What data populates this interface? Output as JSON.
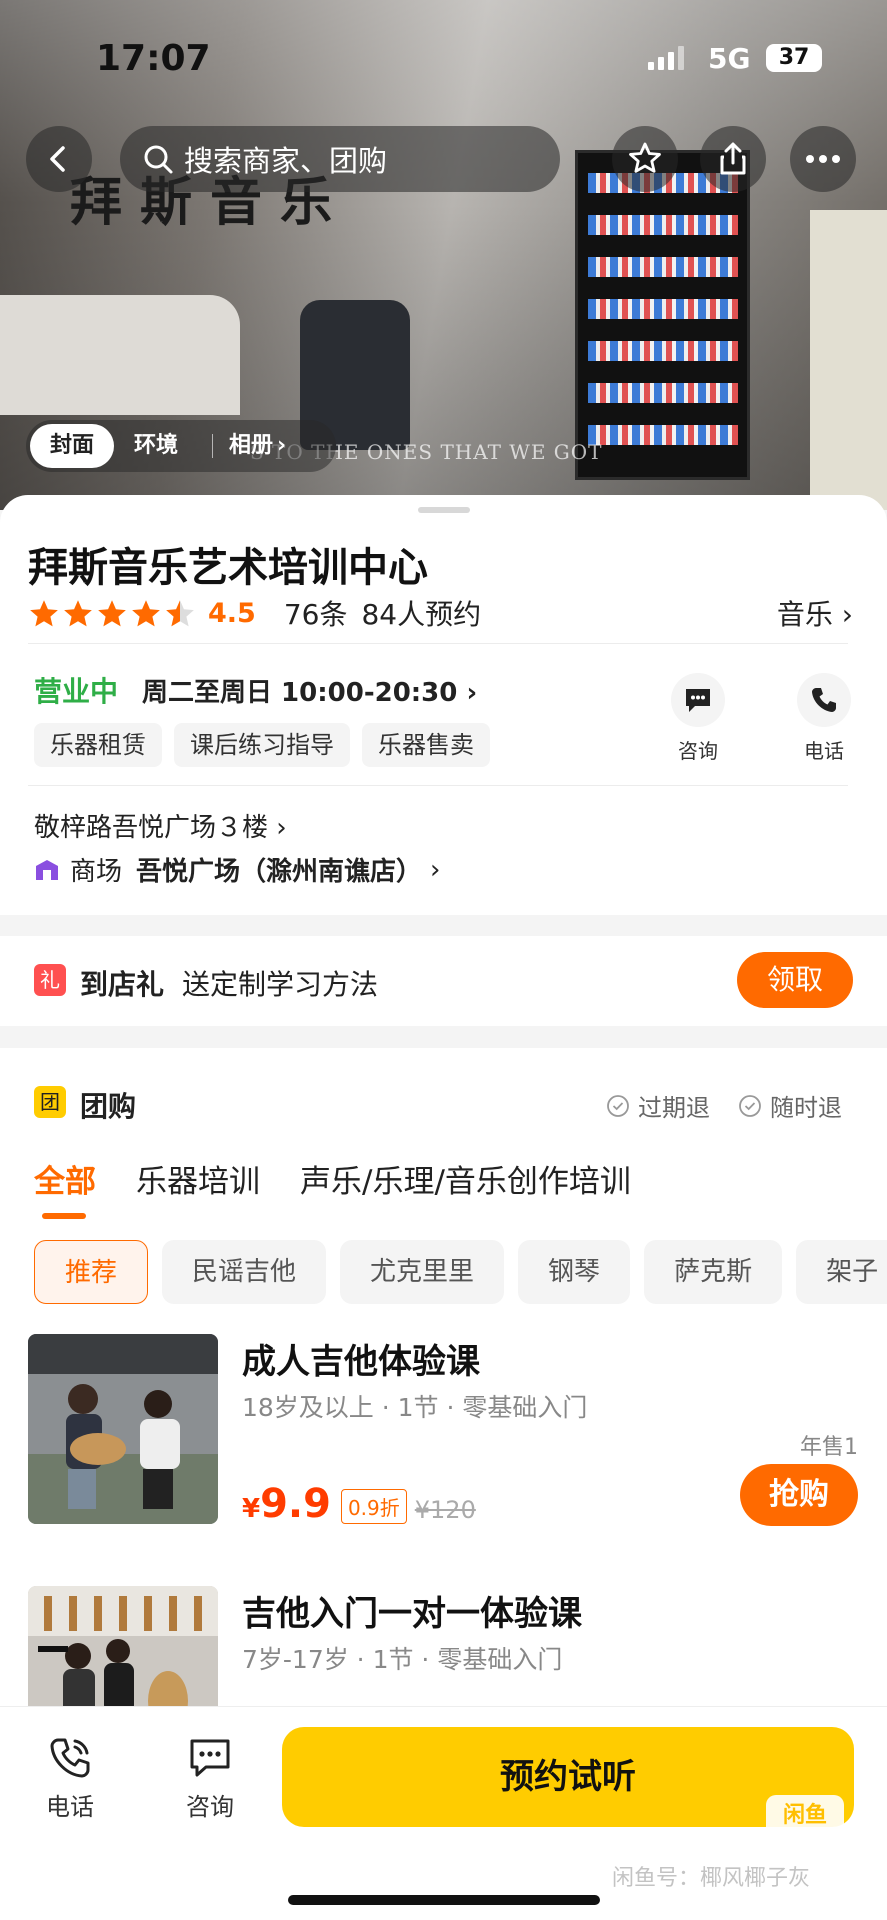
{
  "status_bar": {
    "time": "17:07",
    "network": "5G",
    "battery": "37"
  },
  "search": {
    "placeholder": "搜索商家、团购"
  },
  "hero": {
    "sign_text": "拜斯音乐",
    "wall_text": "S TO THE ONES THAT WE GOT",
    "album_tabs": [
      "封面",
      "环境",
      "相册"
    ]
  },
  "shop": {
    "name": "拜斯音乐艺术培训中心",
    "score": "4.5",
    "stars": 4.5,
    "review_count": "76条",
    "booked": "84人预约",
    "category": "音乐",
    "status": "营业中",
    "hours": "周二至周日 10:00-20:30",
    "tags": [
      "乐器租赁",
      "课后练习指导",
      "乐器售卖"
    ],
    "actions": {
      "consult": "咨询",
      "phone": "电话"
    },
    "address": "敬梓路吾悦广场３楼",
    "mall_label": "商场",
    "mall_name": "吾悦广场（滁州南谯店）"
  },
  "gift": {
    "icon": "礼",
    "title": "到店礼",
    "desc": "送定制学习方法",
    "button": "领取"
  },
  "deals": {
    "icon": "团",
    "title": "团购",
    "refund": [
      "过期退",
      "随时退"
    ],
    "categories": [
      "全部",
      "乐器培训",
      "声乐/乐理/音乐创作培训"
    ],
    "chips": [
      "推荐",
      "民谣吉他",
      "尤克里里",
      "钢琴",
      "萨克斯",
      "架子"
    ],
    "items": [
      {
        "name": "成人吉他体验课",
        "sub": "18岁及以上 · 1节 · 零基础入门",
        "currency": "¥",
        "price": "9.9",
        "discount": "0.9折",
        "original": "¥120",
        "sales": "年售1",
        "buy": "抢购"
      },
      {
        "name": "吉他入门一对一体验课",
        "sub": "7岁-17岁 · 1节 · 零基础入门"
      }
    ]
  },
  "bottom_bar": {
    "phone": "电话",
    "consult": "咨询",
    "book": "预约试听"
  },
  "watermark": {
    "badge": "闲鱼",
    "text": "闲鱼号：椰风椰子灰"
  },
  "colors": {
    "accent": "#ff6a00",
    "open_green": "#2fae47",
    "book_yellow": "#ffcc00"
  }
}
